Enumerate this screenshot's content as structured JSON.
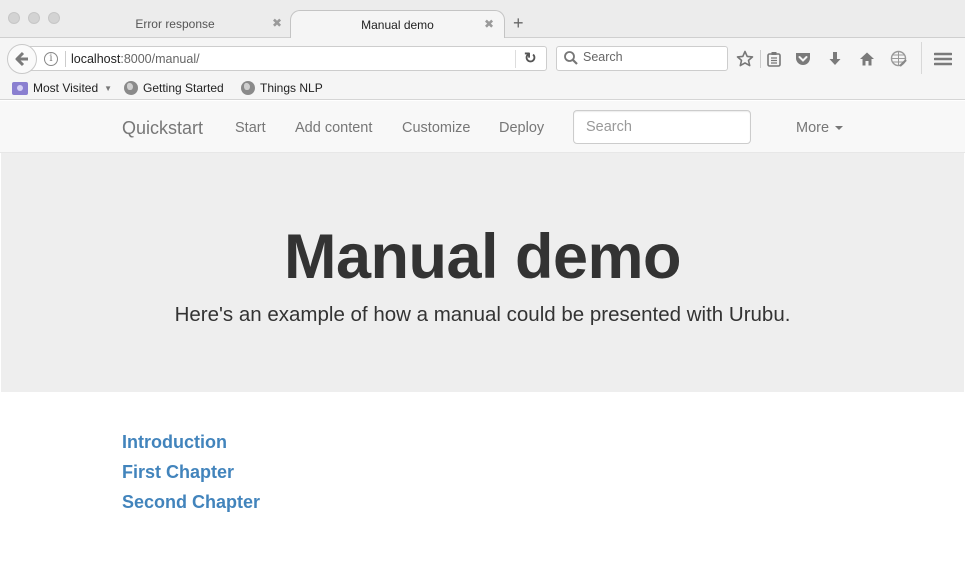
{
  "browser": {
    "tabs": [
      {
        "label": "Error response",
        "active": false
      },
      {
        "label": "Manual demo",
        "active": true
      }
    ],
    "new_tab_label": "+",
    "close_glyph": "✖",
    "url": {
      "host": "localhost",
      "rest": ":8000/manual/"
    },
    "search_placeholder": "Search",
    "toolbar_icons": [
      "bookmark-star-icon",
      "reading-list-icon",
      "pocket-icon",
      "download-icon",
      "home-icon",
      "sync-globe-icon",
      "hamburger-menu-icon"
    ],
    "bookmarks": [
      {
        "label": "Most Visited",
        "icon": "folder-icon",
        "has_dropdown": true
      },
      {
        "label": "Getting Started",
        "icon": "globe-icon"
      },
      {
        "label": "Things NLP",
        "icon": "globe-icon"
      }
    ]
  },
  "site": {
    "brand": "Quickstart",
    "nav": [
      "Start",
      "Add content",
      "Customize",
      "Deploy"
    ],
    "search_placeholder": "Search",
    "more_label": "More",
    "hero": {
      "title": "Manual demo",
      "subtitle": "Here's an example of how a manual could be presented with Urubu."
    },
    "toc": [
      "Introduction",
      "First Chapter",
      "Second Chapter"
    ],
    "colors": {
      "link": "#337ab7",
      "jumbotron_bg": "#eeeeee",
      "navbar_bg": "#f8f8f8"
    }
  }
}
